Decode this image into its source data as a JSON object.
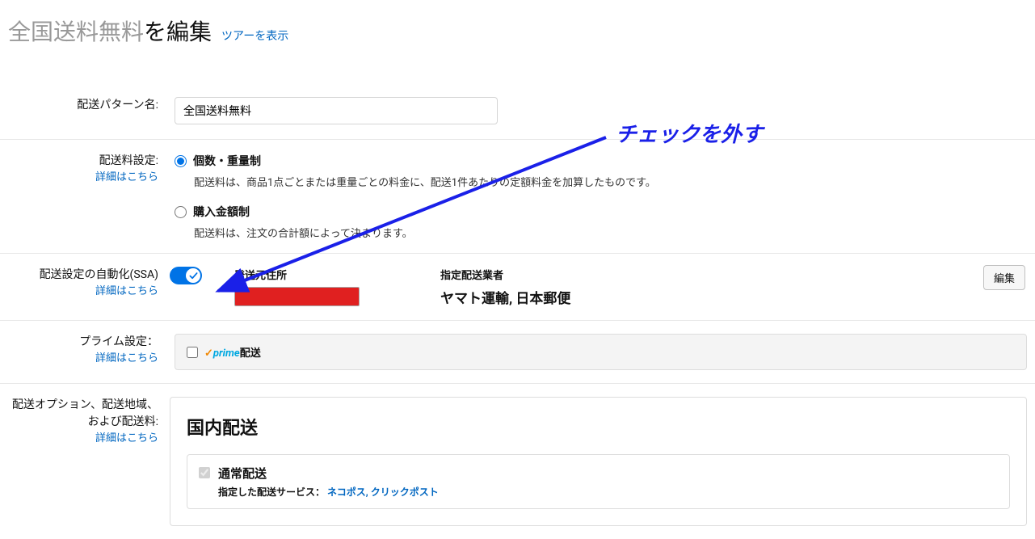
{
  "header": {
    "title_gray": "全国送料無料",
    "title_black": "を編集",
    "tour_link": "ツアーを表示"
  },
  "pattern_name": {
    "label": "配送パターン名:",
    "value": "全国送料無料"
  },
  "shipping_fee": {
    "label": "配送料設定:",
    "detail_link": "詳細はこちら",
    "option1_title": "個数・重量制",
    "option1_desc": "配送料は、商品1点ごとまたは重量ごとの料金に、配送1件あたりの定額料金を加算したものです。",
    "option2_title": "購入金額制",
    "option2_desc": "配送料は、注文の合計額によって決まります。"
  },
  "ssa": {
    "label": "配送設定の自動化(SSA)",
    "detail_link": "詳細はこちら",
    "origin_label": "発送元住所",
    "carrier_label": "指定配送業者",
    "carrier_value": "ヤマト運輸, 日本郵便",
    "edit_button": "編集"
  },
  "prime": {
    "label": "プライム設定：",
    "detail_link": "詳細はこちら",
    "check_glyph": "✓",
    "prime_text": "prime",
    "suffix": "配送"
  },
  "options": {
    "label": "配送オプション、配送地域、および配送料:",
    "detail_link": "詳細はこちら",
    "domestic_title": "国内配送",
    "normal_title": "通常配送",
    "normal_sub_label": "指定した配送サービス：",
    "normal_sub_value": "ネコポス, クリックポスト"
  },
  "annotation": {
    "text": "チェックを外す"
  }
}
